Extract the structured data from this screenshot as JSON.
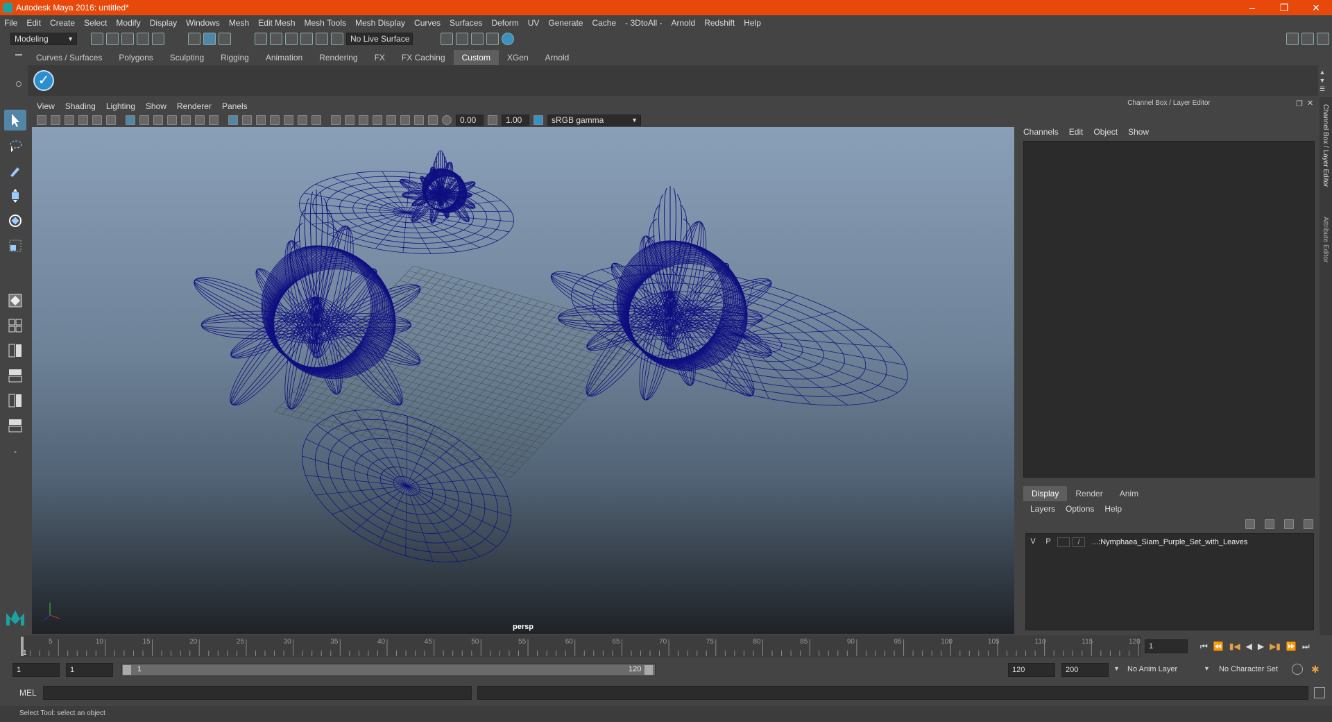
{
  "window": {
    "title": "Autodesk Maya 2016: untitled*"
  },
  "menubar": [
    "File",
    "Edit",
    "Create",
    "Select",
    "Modify",
    "Display",
    "Windows",
    "Mesh",
    "Edit Mesh",
    "Mesh Tools",
    "Mesh Display",
    "Curves",
    "Surfaces",
    "Deform",
    "UV",
    "Generate",
    "Cache",
    "- 3DtoAll -",
    "Arnold",
    "Redshift",
    "Help"
  ],
  "statusline": {
    "menuset": "Modeling",
    "live_surface": "No Live Surface"
  },
  "shelf": {
    "tabs": [
      "Curves / Surfaces",
      "Polygons",
      "Sculpting",
      "Rigging",
      "Animation",
      "Rendering",
      "FX",
      "FX Caching",
      "Custom",
      "XGen",
      "Arnold"
    ],
    "active": "Custom"
  },
  "viewport": {
    "menu": [
      "View",
      "Shading",
      "Lighting",
      "Show",
      "Renderer",
      "Panels"
    ],
    "exposure": "0.00",
    "gamma": "1.00",
    "colorspace": "sRGB gamma",
    "camera": "persp",
    "wire_color": "#0f0f80"
  },
  "channelbox": {
    "title": "Channel Box / Layer Editor",
    "menu": [
      "Channels",
      "Edit",
      "Object",
      "Show"
    ]
  },
  "layereditor": {
    "tabs": [
      "Display",
      "Render",
      "Anim"
    ],
    "active": "Display",
    "menu": [
      "Layers",
      "Options",
      "Help"
    ],
    "layers": [
      {
        "v": "V",
        "p": "P",
        "name": "...:Nymphaea_Siam_Purple_Set_with_Leaves"
      }
    ]
  },
  "side_tabs": [
    "Channel Box / Layer Editor",
    "Attribute Editor"
  ],
  "timeline": {
    "ticks": [
      5,
      10,
      15,
      20,
      25,
      30,
      35,
      40,
      45,
      50,
      55,
      60,
      65,
      70,
      75,
      80,
      85,
      90,
      95,
      100,
      105,
      110,
      115,
      120
    ],
    "current": "1",
    "current_field": "1"
  },
  "range": {
    "start": "1",
    "start_inner": "1",
    "slider_start": "1",
    "slider_end": "120",
    "end_inner": "120",
    "end": "200",
    "anim_layer": "No Anim Layer",
    "char_set": "No Character Set"
  },
  "command": {
    "label": "MEL"
  },
  "helpline": "Select Tool: select an object"
}
